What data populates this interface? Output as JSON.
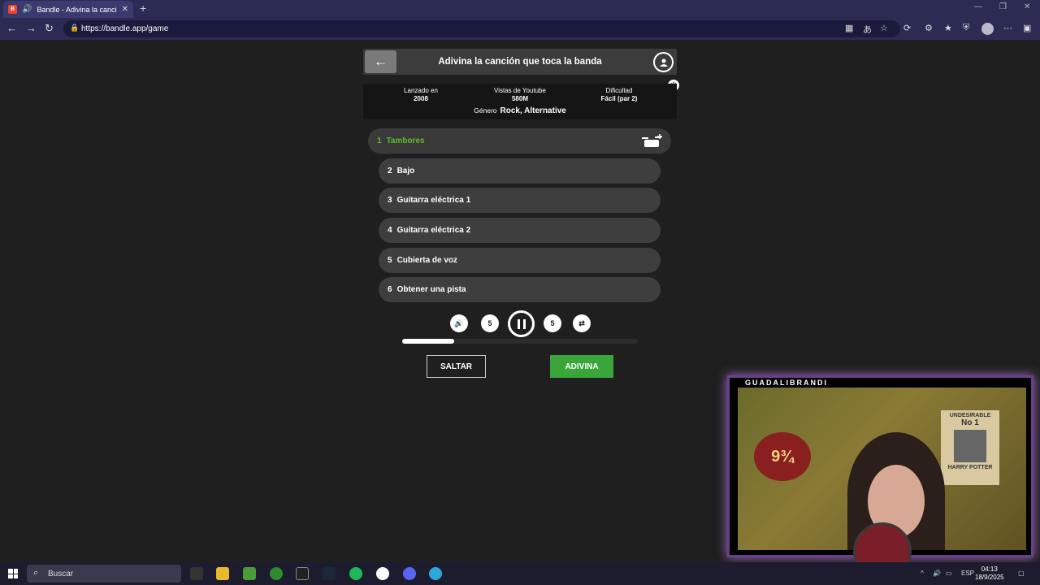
{
  "browser": {
    "tab_title": "Bandle - Adivina la canción, ...",
    "favicon_letter": "B",
    "url": "https://bandle.app/game"
  },
  "game": {
    "header_title": "Adivina la canción que toca la banda",
    "info": {
      "released_label": "Lanzado en",
      "released_value": "2008",
      "views_label": "Vistas de Youtube",
      "views_value": "580M",
      "difficulty_label": "Dificultad",
      "difficulty_value": "Fácil (par 2)",
      "genre_label": "Género",
      "genre_value": "Rock, Alternative"
    },
    "tracks": [
      {
        "num": "1",
        "label": "Tambores",
        "active": true
      },
      {
        "num": "2",
        "label": "Bajo"
      },
      {
        "num": "3",
        "label": "Guitarra eléctrica 1"
      },
      {
        "num": "4",
        "label": "Guitarra eléctrica 2"
      },
      {
        "num": "5",
        "label": "Cubierta de voz"
      },
      {
        "num": "6",
        "label": "Obtener una pista"
      }
    ],
    "controls": {
      "rewind_label": "5",
      "forward_label": "5"
    },
    "progress_fraction": 0.22,
    "skip_label": "SALTAR",
    "guess_label": "ADIVINA"
  },
  "webcam": {
    "label": "GUADALIBRANDI",
    "poster_left": "9¾",
    "poster_right_1": "UNDESIRABLE",
    "poster_right_2": "No 1",
    "poster_right_3": "HARRY POTTER"
  },
  "taskbar": {
    "search_placeholder": "Buscar",
    "language": "ESP",
    "time": "04:13",
    "date": "18/9/2025"
  }
}
